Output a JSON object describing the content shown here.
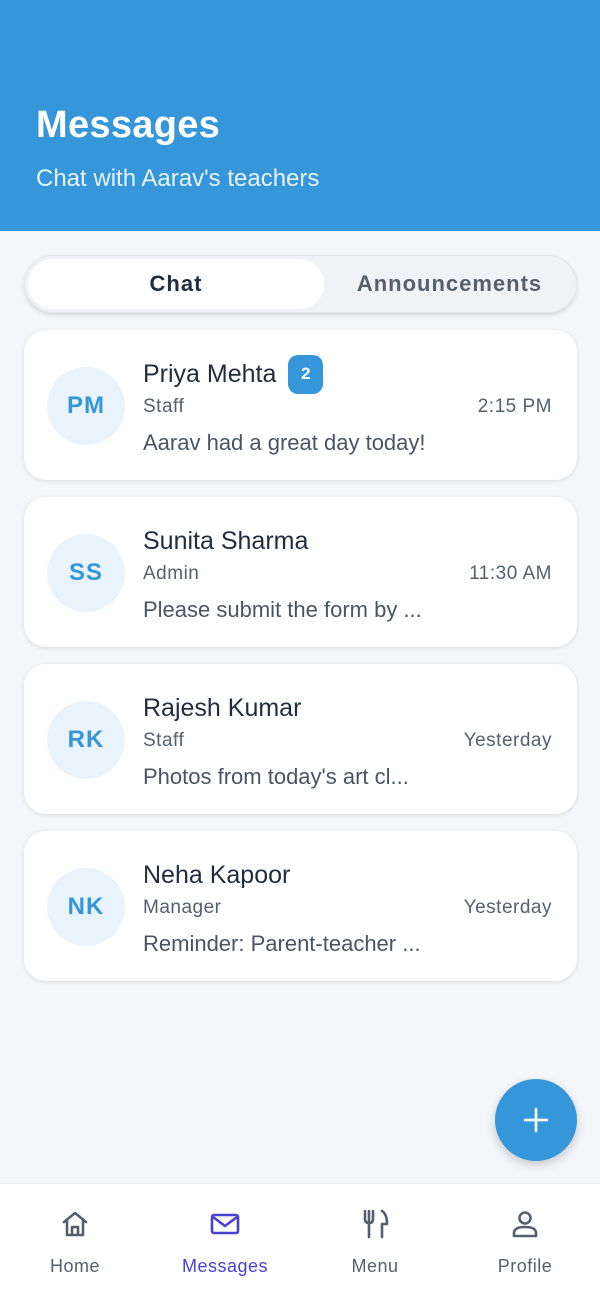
{
  "header": {
    "title": "Messages",
    "subtitle": "Chat with Aarav's teachers"
  },
  "tabs": [
    {
      "label": "Chat",
      "active": true
    },
    {
      "label": "Announcements",
      "active": false
    }
  ],
  "conversations": [
    {
      "initials": "PM",
      "name": "Priya Mehta",
      "role": "Staff",
      "time": "2:15 PM",
      "preview": "Aarav had a great day today!",
      "unread": "2"
    },
    {
      "initials": "SS",
      "name": "Sunita Sharma",
      "role": "Admin",
      "time": "11:30 AM",
      "preview": "Please submit the form by ..."
    },
    {
      "initials": "RK",
      "name": "Rajesh Kumar",
      "role": "Staff",
      "time": "Yesterday",
      "preview": "Photos from today's art cl..."
    },
    {
      "initials": "NK",
      "name": "Neha Kapoor",
      "role": "Manager",
      "time": "Yesterday",
      "preview": "Reminder: Parent-teacher ..."
    }
  ],
  "fab": {
    "icon": "plus-icon"
  },
  "bottom_nav": [
    {
      "label": "Home",
      "icon": "home-icon",
      "active": false
    },
    {
      "label": "Messages",
      "icon": "mail-icon",
      "active": true
    },
    {
      "label": "Menu",
      "icon": "fork-knife-icon",
      "active": false
    },
    {
      "label": "Profile",
      "icon": "person-icon",
      "active": false
    }
  ],
  "colors": {
    "header_bg": "#3597da",
    "accent": "#3597da",
    "nav_active": "#4b3fd6",
    "nav_inactive": "#55606d",
    "background": "#f4f6f9"
  }
}
